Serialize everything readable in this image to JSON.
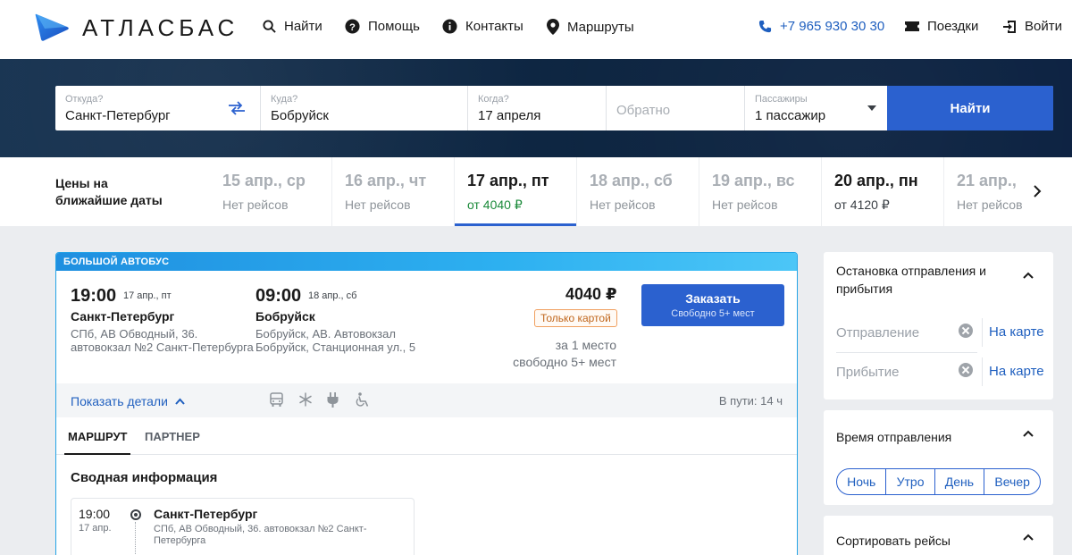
{
  "brand": {
    "name": "АТЛАСБАС"
  },
  "nav": {
    "find": "Найти",
    "help": "Помощь",
    "contacts": "Контакты",
    "routes": "Маршруты",
    "phone": "+7 965 930 30 30",
    "trips": "Поездки",
    "login": "Войти"
  },
  "search": {
    "from_label": "Откуда?",
    "from_value": "Санкт-Петербург",
    "to_label": "Куда?",
    "to_value": "Бобруйск",
    "when_label": "Когда?",
    "when_value": "17 апреля",
    "return_placeholder": "Обратно",
    "passengers_label": "Пассажиры",
    "passengers_value": "1 пассажир",
    "submit": "Найти"
  },
  "dates": {
    "title": "Цены на ближайшие даты",
    "items": [
      {
        "date": "15 апр., ср",
        "sub": "Нет рейсов"
      },
      {
        "date": "16 апр., чт",
        "sub": "Нет рейсов"
      },
      {
        "date": "17 апр., пт",
        "sub": "от 4040 ₽"
      },
      {
        "date": "18 апр., сб",
        "sub": "Нет рейсов"
      },
      {
        "date": "19 апр., вс",
        "sub": "Нет рейсов"
      },
      {
        "date": "20 апр., пн",
        "sub": "от 4120 ₽"
      },
      {
        "date": "21 апр.,",
        "sub": "Нет рейсов"
      }
    ]
  },
  "trip": {
    "tag": "БОЛЬШОЙ АВТОБУС",
    "dep_time": "19:00",
    "dep_date": "17 апр., пт",
    "dep_city": "Санкт-Петербург",
    "dep_addr_1": "СПб, АВ Обводный, 36.",
    "dep_addr_2": "автовокзал №2 Санкт-Петербурга",
    "arr_time": "09:00",
    "arr_date": "18 апр., сб",
    "arr_city": "Бобруйск",
    "arr_addr_1": "Бобруйск, АВ. Автовокзал",
    "arr_addr_2": "Бобруйск, Станционная ул., 5",
    "price": "4040 ₽",
    "card_only": "Только картой",
    "per_seat": "за 1 место",
    "free_seats": "свободно 5+ мест",
    "order": "Заказать",
    "order_sub": "Свободно 5+ мест",
    "details": "Показать детали",
    "duration": "В пути: 14 ч",
    "amenities": [
      "bus-icon",
      "snowflake-icon",
      "plug-icon",
      "wheelchair-icon"
    ],
    "tabs": [
      "МАРШРУТ",
      "ПАРТНЕР"
    ],
    "summary_title": "Сводная информация",
    "stop": {
      "time": "19:00",
      "date": "17 апр.",
      "city": "Санкт-Петербург",
      "addr": "СПб, АВ Обводный, 36. автовокзал №2 Санкт-Петербурга"
    }
  },
  "filters": {
    "stops_title": "Остановка отправления и прибытия",
    "departure_placeholder": "Отправление",
    "arrival_placeholder": "Прибытие",
    "on_map": "На карте",
    "time_title": "Время отправления",
    "time_options": [
      "Ночь",
      "Утро",
      "День",
      "Вечер"
    ],
    "sort_title": "Сортировать рейсы"
  },
  "colors": {
    "accent": "#2b61cf",
    "link": "#1f5fbf",
    "price_green": "#1b8a3a",
    "card_only_orange": "#c0661c"
  }
}
